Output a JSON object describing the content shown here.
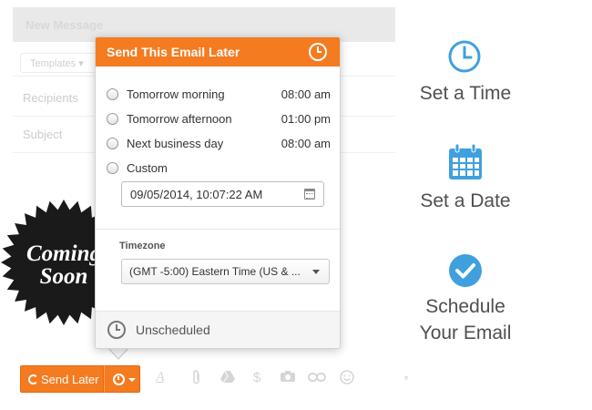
{
  "compose": {
    "title": "New Message",
    "templates_label": "Templates",
    "recipients_placeholder": "Recipients",
    "subject_placeholder": "Subject",
    "send_later_label": "Send Later"
  },
  "popup": {
    "title": "Send This Email Later",
    "options": [
      {
        "label": "Tomorrow morning",
        "time": "08:00 am"
      },
      {
        "label": "Tomorrow afternoon",
        "time": "01:00 pm"
      },
      {
        "label": "Next business day",
        "time": "08:00 am"
      },
      {
        "label": "Custom",
        "time": ""
      }
    ],
    "custom_datetime": "09/05/2014, 10:07:22 AM",
    "timezone_label": "Timezone",
    "timezone_value": "(GMT -5:00) Eastern Time (US & ...",
    "status": "Unscheduled"
  },
  "badge": {
    "line1": "Coming",
    "line2": "Soon",
    "color": "#1a1a1a"
  },
  "features": [
    {
      "icon": "clock-icon",
      "label": "Set a Time"
    },
    {
      "icon": "calendar-icon",
      "label": "Set a Date"
    },
    {
      "icon": "checkmark-circle-icon",
      "label_line1": "Schedule",
      "label_line2": "Your Email"
    }
  ],
  "colors": {
    "accent": "#f47b20",
    "feature_icon": "#3fa0de"
  }
}
